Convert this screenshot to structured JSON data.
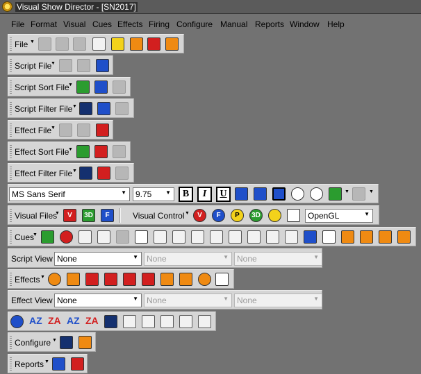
{
  "window": {
    "title": "Visual Show Director - [SN2017]"
  },
  "menu": [
    "File",
    "Format",
    "Visual",
    "Cues",
    "Effects",
    "Firing",
    "Configure",
    "Manual",
    "Reports",
    "Window",
    "Help"
  ],
  "toolbars": {
    "file": "File",
    "script_file": "Script File",
    "script_sort_file": "Script Sort File",
    "script_filter_file": "Script Filter File",
    "effect_file": "Effect File",
    "effect_sort_file": "Effect Sort File",
    "effect_filter_file": "Effect Filter File",
    "visual_files": "Visual Files",
    "visual_control": "Visual Control",
    "cues": "Cues",
    "script_view": "Script View",
    "effects": "Effects",
    "effect_view": "Effect View",
    "configure": "Configure",
    "reports": "Reports"
  },
  "format": {
    "font": "MS Sans Serif",
    "size": "9.75",
    "bold": "B",
    "italic": "I",
    "underline": "U"
  },
  "visual": {
    "renderer": "OpenGL",
    "logo_v": "V",
    "logo_3d": "3D",
    "logo_f": "F"
  },
  "visual_control": {
    "v": "V",
    "f": "F",
    "p": "P",
    "three_d": "3D"
  },
  "script_view": {
    "view1": "None",
    "view2": "None",
    "view3": "None"
  },
  "effect_view": {
    "view1": "None",
    "view2": "None",
    "view3": "None"
  },
  "sort": {
    "az1": "AZ",
    "za": "ZA",
    "az2": "AZ",
    "za2": "ZA"
  },
  "colors": {
    "background": "#727272",
    "toolbar": "#d5d5d5",
    "titlebar": "#5b5b5b"
  }
}
